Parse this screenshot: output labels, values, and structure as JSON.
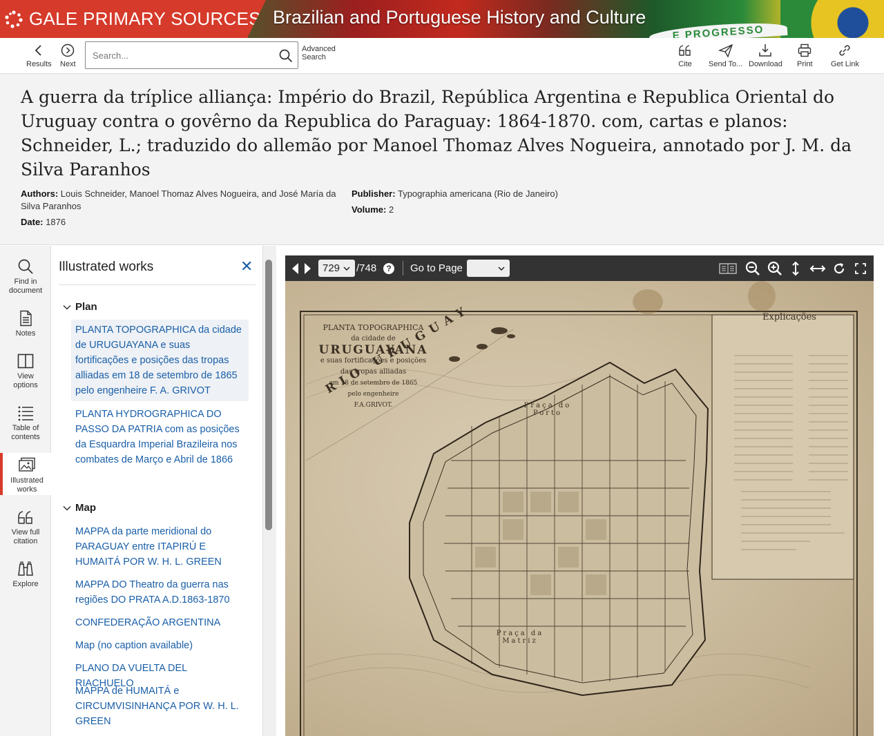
{
  "banner": {
    "brand": "GALE PRIMARY SOURCES",
    "collection": "Brazilian and Portuguese History and Culture",
    "flag_motto": "E PROGRESSO",
    "brand_color": "#d63a2a"
  },
  "toolbar": {
    "results_label": "Results",
    "next_label": "Next",
    "search_placeholder": "Search...",
    "advanced_line1": "Advanced",
    "advanced_line2": "Search",
    "cite_label": "Cite",
    "send_label": "Send To...",
    "download_label": "Download",
    "print_label": "Print",
    "getlink_label": "Get Link"
  },
  "document": {
    "title": "A guerra da tríplice alliança: Império do Brazil, República Argentina e Republica Oriental do Uruguay contra o govêrno da Republica do Paraguay: 1864-1870. com, cartas e planos: Schneider, L.; traduzido do allemão por Manoel Thomaz Alves Nogueira, annotado por J. M. da Silva Paranhos",
    "authors_label": "Authors:",
    "authors_value": "Louis Schneider, Manoel Thomaz Alves Nogueira, and José María da Silva Paranhos",
    "publisher_label": "Publisher:",
    "publisher_value": "Typographia americana (Rio de Janeiro)",
    "date_label": "Date:",
    "date_value": "1876",
    "volume_label": "Volume:",
    "volume_value": "2"
  },
  "rail": {
    "find_line1": "Find in",
    "find_line2": "document",
    "notes": "Notes",
    "view_line1": "View",
    "view_line2": "options",
    "toc_line1": "Table of",
    "toc_line2": "contents",
    "illustrated_line1": "Illustrated",
    "illustrated_line2": "works",
    "citation_line1": "View full",
    "citation_line2": "citation",
    "explore": "Explore"
  },
  "panel": {
    "heading": "Illustrated works",
    "close_symbol": "✕",
    "groups": [
      {
        "name": "Plan",
        "items": [
          "PLANTA TOPOGRAPHICA da cidade de URUGUAYANA e suas fortificações e posições das tropas alliadas em 18 de setembro de 1865 pelo engenheire F. A. GRIVOT",
          "PLANTA HYDROGRAPHICA DO PASSO DA PATRIA com as posições da Esquardra Imperial Brazileira nos combates de Março e Abril de 1866"
        ]
      },
      {
        "name": "Map",
        "items": [
          "MAPPA da parte meridional do PARAGUAY entre ITAPIRÚ E HUMAITÁ POR W. H. L. GREEN",
          "MAPPA DO Theatro da guerra nas regiões DO PRATA A.D.1863-1870",
          "CONFEDERAÇÃO ARGENTINA",
          "Map (no caption available)",
          "PLANO DA VUELTA DEL RIACHUELO",
          "MAPPA de HUMAITÁ e CIRCUMVISINHANÇA POR W. H. L. GREEN"
        ]
      }
    ]
  },
  "viewer": {
    "page_current": "729",
    "page_total": "/748",
    "help_symbol": "?",
    "goto_label": "Go to Page",
    "map": {
      "title1": "PLANTA TOPOGRAPHICA",
      "title2": "da cidade de",
      "title3": "URUGUAYANA",
      "title4": "e suas fortificações e posições",
      "title5": "das tropas alliadas",
      "title6": "em 18 de setembro de 1865",
      "title7": "pelo engenheire",
      "title8": "F.A.GRIVOT.",
      "river": "RIO URUGUAY",
      "legend_title": "Explicações",
      "praca_porto": "Praça do Porto",
      "praca_matriz": "Praça da Matriz"
    }
  }
}
